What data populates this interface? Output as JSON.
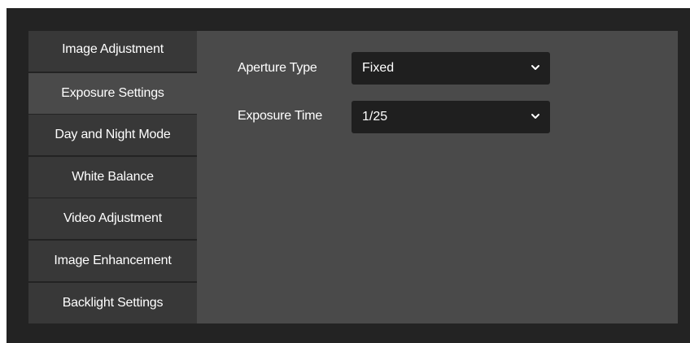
{
  "sidebar": {
    "items": [
      {
        "label": "Image Adjustment",
        "active": false
      },
      {
        "label": "Exposure Settings",
        "active": true
      },
      {
        "label": "Day and Night Mode",
        "active": false
      },
      {
        "label": "White Balance",
        "active": false
      },
      {
        "label": "Video Adjustment",
        "active": false
      },
      {
        "label": "Image Enhancement",
        "active": false
      },
      {
        "label": "Backlight Settings",
        "active": false
      }
    ]
  },
  "settings": {
    "aperture_type": {
      "label": "Aperture Type",
      "value": "Fixed"
    },
    "exposure_time": {
      "label": "Exposure Time",
      "value": "1/25"
    }
  },
  "icons": {
    "dropdown": "chevron-down-icon"
  },
  "colors": {
    "frame": "#232323",
    "sidebar_item": "#383838",
    "sidebar_active": "#4a4a4a",
    "panel": "#4a4a4a",
    "select_bg": "#1f1f1f",
    "text": "#ffffff"
  }
}
